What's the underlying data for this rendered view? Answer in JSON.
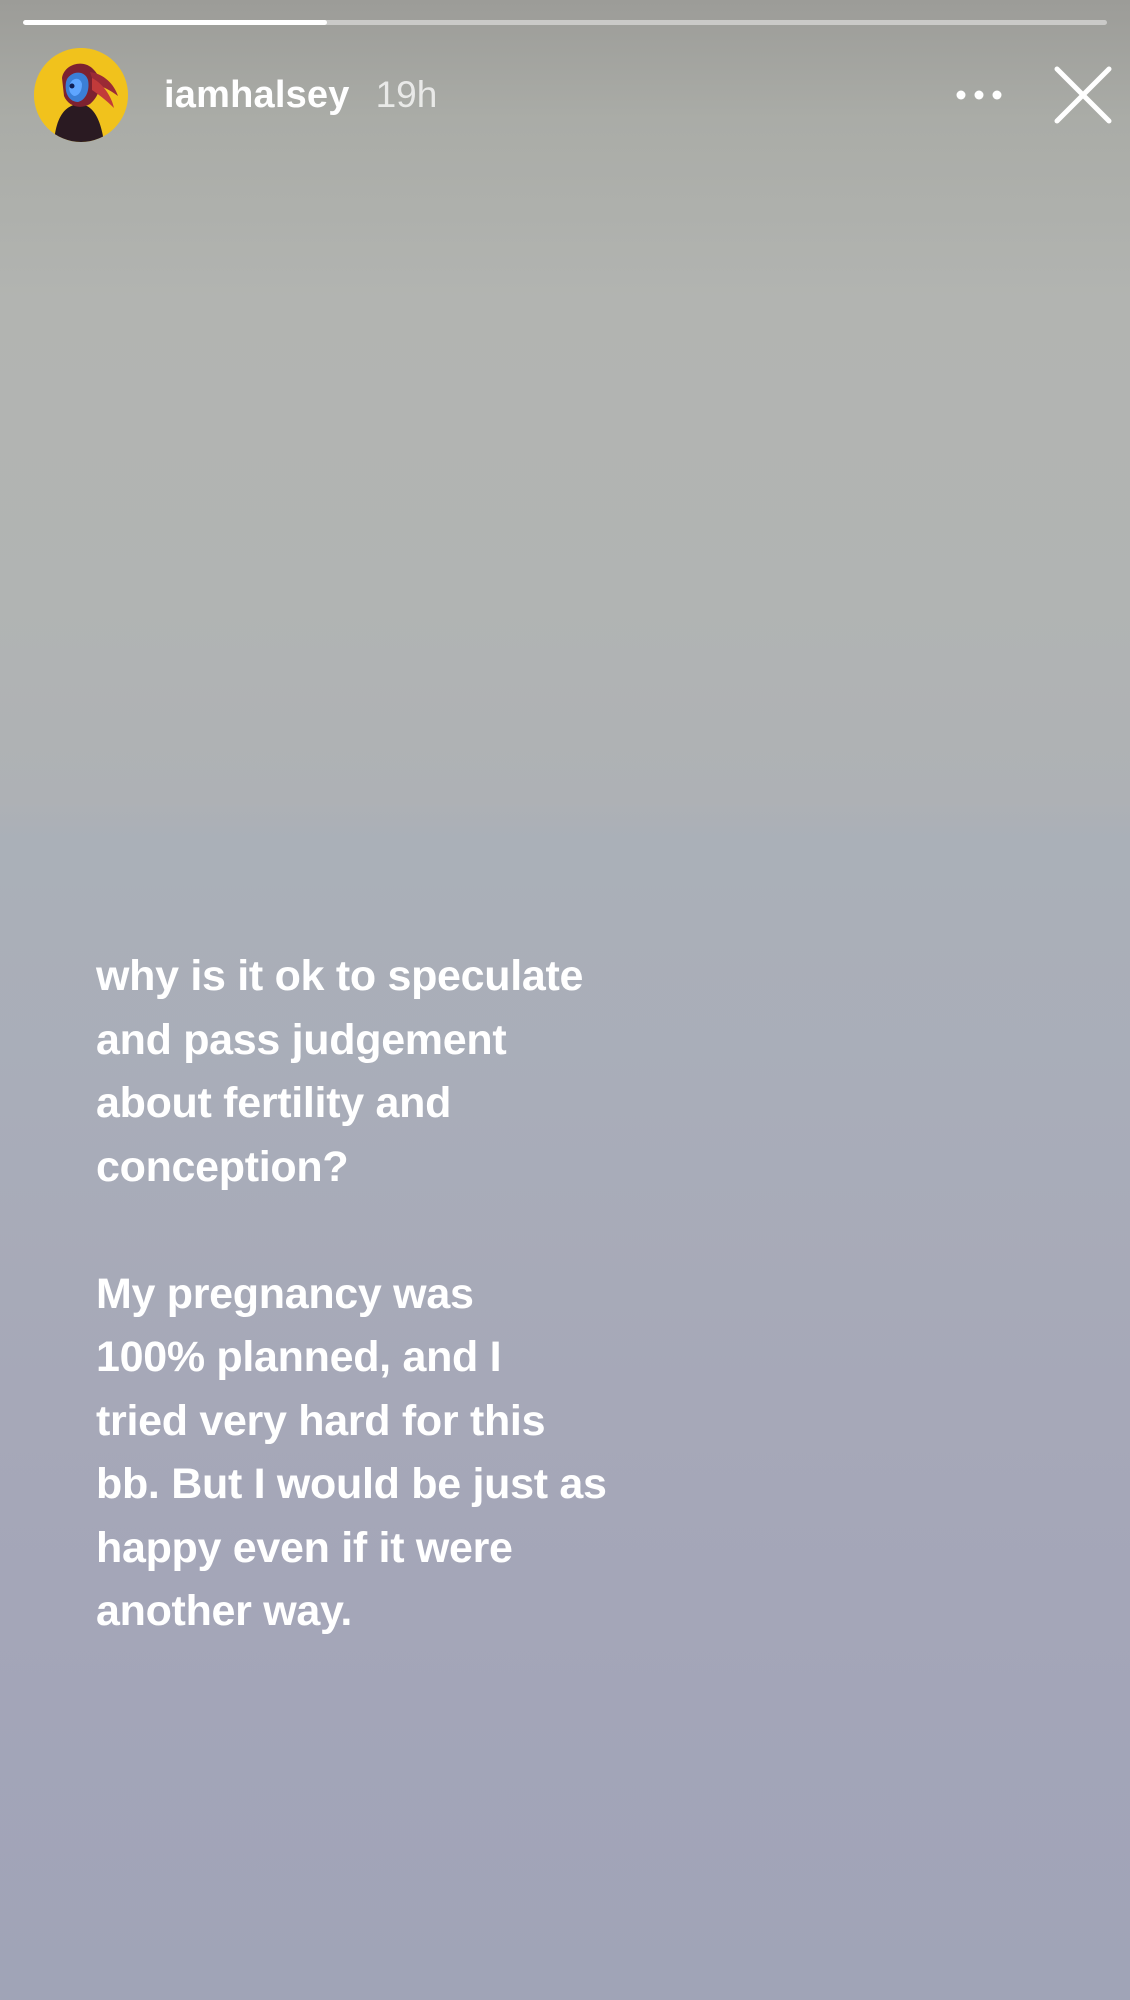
{
  "story": {
    "progress_fraction": 0.28,
    "user": {
      "username": "iamhalsey",
      "timestamp": "19h",
      "avatar_icon": "profile-photo"
    },
    "actions": {
      "more_icon": "ellipsis-icon",
      "close_icon": "close-icon"
    },
    "text": {
      "paragraph1": [
        "why is it ok to speculate",
        "and pass judgement",
        "about fertility and",
        "conception?"
      ],
      "paragraph2": [
        "My pregnancy was",
        "100% planned, and I",
        "tried very hard for this",
        "bb. But I would be just as",
        "happy even if it were",
        "another way."
      ]
    },
    "colors": {
      "text": "#ffffff",
      "avatar_bg": "#f3c51d"
    }
  }
}
